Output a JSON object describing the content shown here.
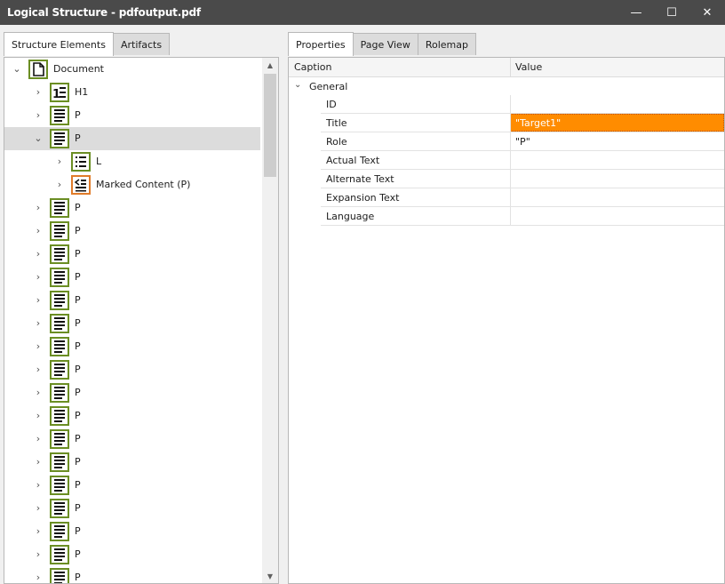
{
  "window": {
    "title": "Logical Structure - pdfoutput.pdf",
    "minimize_glyph": "—",
    "maximize_glyph": "☐",
    "close_glyph": "✕"
  },
  "left": {
    "tabs": [
      {
        "label": "Structure Elements",
        "active": true
      },
      {
        "label": "Artifacts",
        "active": false
      }
    ],
    "tree": [
      {
        "label": "Document",
        "icon": "document-icon",
        "level": 0,
        "expanded": true,
        "selected": false
      },
      {
        "label": "H1",
        "icon": "heading-icon",
        "level": 1,
        "expanded": false,
        "selected": false
      },
      {
        "label": "P",
        "icon": "paragraph-icon",
        "level": 1,
        "expanded": false,
        "selected": false
      },
      {
        "label": "P",
        "icon": "paragraph-icon",
        "level": 1,
        "expanded": true,
        "selected": true
      },
      {
        "label": "L",
        "icon": "list-icon",
        "level": 2,
        "expanded": false,
        "selected": false
      },
      {
        "label": "Marked Content (P)",
        "icon": "marked-content-icon",
        "level": 2,
        "expanded": false,
        "selected": false
      },
      {
        "label": "P",
        "icon": "paragraph-icon",
        "level": 1,
        "expanded": false,
        "selected": false
      },
      {
        "label": "P",
        "icon": "paragraph-icon",
        "level": 1,
        "expanded": false,
        "selected": false
      },
      {
        "label": "P",
        "icon": "paragraph-icon",
        "level": 1,
        "expanded": false,
        "selected": false
      },
      {
        "label": "P",
        "icon": "paragraph-icon",
        "level": 1,
        "expanded": false,
        "selected": false
      },
      {
        "label": "P",
        "icon": "paragraph-icon",
        "level": 1,
        "expanded": false,
        "selected": false
      },
      {
        "label": "P",
        "icon": "paragraph-icon",
        "level": 1,
        "expanded": false,
        "selected": false
      },
      {
        "label": "P",
        "icon": "paragraph-icon",
        "level": 1,
        "expanded": false,
        "selected": false
      },
      {
        "label": "P",
        "icon": "paragraph-icon",
        "level": 1,
        "expanded": false,
        "selected": false
      },
      {
        "label": "P",
        "icon": "paragraph-icon",
        "level": 1,
        "expanded": false,
        "selected": false
      },
      {
        "label": "P",
        "icon": "paragraph-icon",
        "level": 1,
        "expanded": false,
        "selected": false
      },
      {
        "label": "P",
        "icon": "paragraph-icon",
        "level": 1,
        "expanded": false,
        "selected": false
      },
      {
        "label": "P",
        "icon": "paragraph-icon",
        "level": 1,
        "expanded": false,
        "selected": false
      },
      {
        "label": "P",
        "icon": "paragraph-icon",
        "level": 1,
        "expanded": false,
        "selected": false
      },
      {
        "label": "P",
        "icon": "paragraph-icon",
        "level": 1,
        "expanded": false,
        "selected": false
      },
      {
        "label": "P",
        "icon": "paragraph-icon",
        "level": 1,
        "expanded": false,
        "selected": false
      },
      {
        "label": "P",
        "icon": "paragraph-icon",
        "level": 1,
        "expanded": false,
        "selected": false
      },
      {
        "label": "P",
        "icon": "paragraph-icon",
        "level": 1,
        "expanded": false,
        "selected": false
      }
    ]
  },
  "right": {
    "tabs": [
      {
        "label": "Properties",
        "active": true
      },
      {
        "label": "Page View",
        "active": false
      },
      {
        "label": "Rolemap",
        "active": false
      }
    ],
    "grid": {
      "columns": [
        "Caption",
        "Value"
      ],
      "group": "General",
      "rows": [
        {
          "caption": "ID",
          "value": "",
          "highlighted": false
        },
        {
          "caption": "Title",
          "value": "\"Target1\"",
          "highlighted": true
        },
        {
          "caption": "Role",
          "value": "\"P\"",
          "highlighted": false
        },
        {
          "caption": "Actual Text",
          "value": "",
          "highlighted": false
        },
        {
          "caption": "Alternate Text",
          "value": "",
          "highlighted": false
        },
        {
          "caption": "Expansion Text",
          "value": "",
          "highlighted": false
        },
        {
          "caption": "Language",
          "value": "",
          "highlighted": false
        }
      ]
    }
  },
  "colors": {
    "icon_green": "#6b8e23",
    "icon_orange": "#e07b2a",
    "highlight": "#ff8c00",
    "selection": "#dcdcdc",
    "titlebar": "#4a4a4a"
  }
}
